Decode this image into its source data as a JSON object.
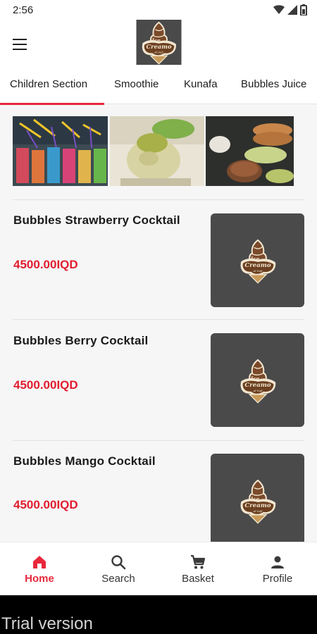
{
  "status_bar": {
    "time": "2:56"
  },
  "app_bar": {
    "logo_text": "Ice Creamo",
    "logo_subtext": "Al-Safi"
  },
  "tabs": [
    {
      "label": "Children Section",
      "active": true
    },
    {
      "label": "Smoothie",
      "active": false
    },
    {
      "label": "Kunafa",
      "active": false
    },
    {
      "label": "Bubbles Juice",
      "active": false
    }
  ],
  "products": [
    {
      "name": "Bubbles Strawberry Cocktail",
      "price": "4500.00IQD"
    },
    {
      "name": "Bubbles Berry Cocktail",
      "price": "4500.00IQD"
    },
    {
      "name": "Bubbles Mango Cocktail",
      "price": "4500.00IQD"
    }
  ],
  "bottom_nav": [
    {
      "label": "Home",
      "icon": "home-icon",
      "active": true
    },
    {
      "label": "Search",
      "icon": "search-icon",
      "active": false
    },
    {
      "label": "Basket",
      "icon": "cart-icon",
      "active": false
    },
    {
      "label": "Profile",
      "icon": "person-icon",
      "active": false
    }
  ],
  "footer": {
    "trial_text": "Trial version"
  },
  "colors": {
    "accent": "#e8283b",
    "price": "#e11d2f",
    "thumb_bg": "#4a4a4a"
  }
}
